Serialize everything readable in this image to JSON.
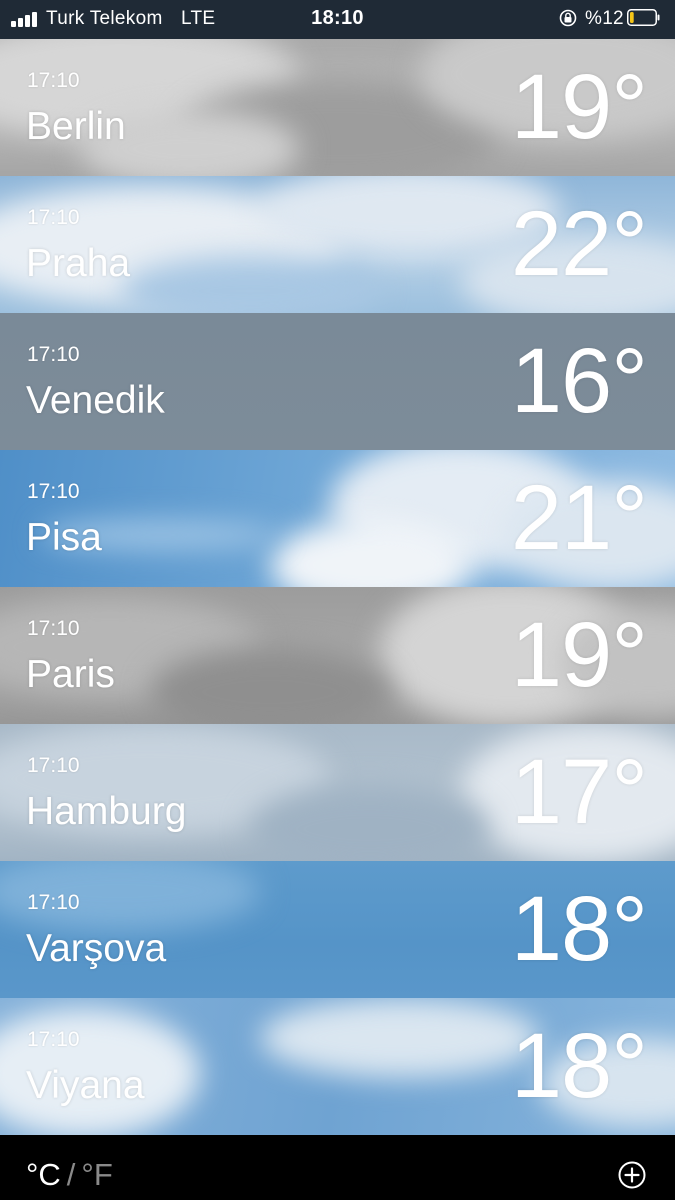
{
  "status_bar": {
    "carrier": "Turk Telekom",
    "network": "LTE",
    "time": "18:10",
    "battery_percent": "%12",
    "battery_level": 0.12,
    "battery_color": "#f5c518"
  },
  "cities": [
    {
      "time": "17:10",
      "name": "Berlin",
      "temp": "19°"
    },
    {
      "time": "17:10",
      "name": "Praha",
      "temp": "22°"
    },
    {
      "time": "17:10",
      "name": "Venedik",
      "temp": "16°"
    },
    {
      "time": "17:10",
      "name": "Pisa",
      "temp": "21°"
    },
    {
      "time": "17:10",
      "name": "Paris",
      "temp": "19°"
    },
    {
      "time": "17:10",
      "name": "Hamburg",
      "temp": "17°"
    },
    {
      "time": "17:10",
      "name": "Varşova",
      "temp": "18°"
    },
    {
      "time": "17:10",
      "name": "Viyana",
      "temp": "18°"
    }
  ],
  "bottom_bar": {
    "celsius_label": "°C",
    "separator": "/",
    "fahrenheit_label": "°F",
    "add_icon": "plus-circle-icon"
  }
}
